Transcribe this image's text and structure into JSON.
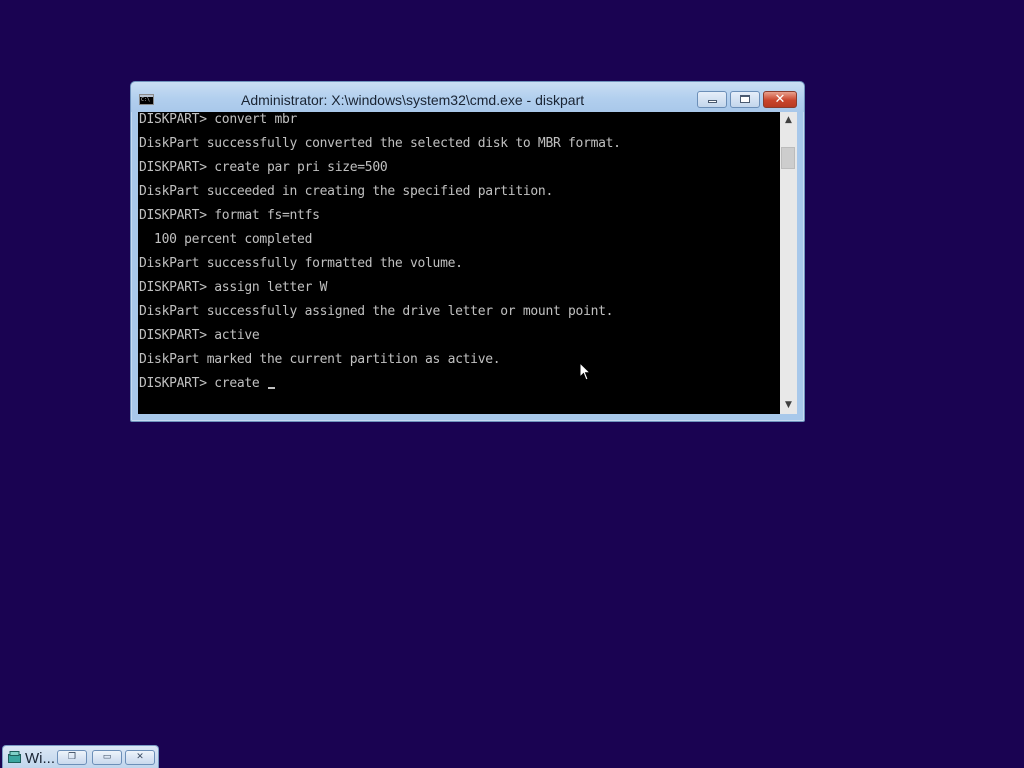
{
  "window": {
    "title": "Administrator: X:\\windows\\system32\\cmd.exe - diskpart"
  },
  "console": {
    "lines": [
      "DISKPART> convert mbr",
      "DiskPart successfully converted the selected disk to MBR format.",
      "DISKPART> create par pri size=500",
      "DiskPart succeeded in creating the specified partition.",
      "DISKPART> format fs=ntfs",
      "  100 percent completed",
      "DiskPart successfully formatted the volume.",
      "DISKPART> assign letter W",
      "DiskPart successfully assigned the drive letter or mount point.",
      "DISKPART> active",
      "DiskPart marked the current partition as active.",
      "DISKPART> create "
    ]
  },
  "minimized_window": {
    "label": "Wi..."
  },
  "icons": {
    "app": "cmd-icon",
    "minimize": "minimize-icon",
    "maximize": "maximize-icon",
    "close": "close-icon",
    "scroll_up": "chevron-up-icon",
    "scroll_down": "chevron-down-icon",
    "pointer": "mouse-pointer-icon",
    "setup": "setup-icon",
    "restore": "restore-icon"
  },
  "colors": {
    "desktop": "#1a0352",
    "console_bg": "#000000",
    "console_text": "#c0c0c0",
    "close_button": "#c9452c"
  }
}
